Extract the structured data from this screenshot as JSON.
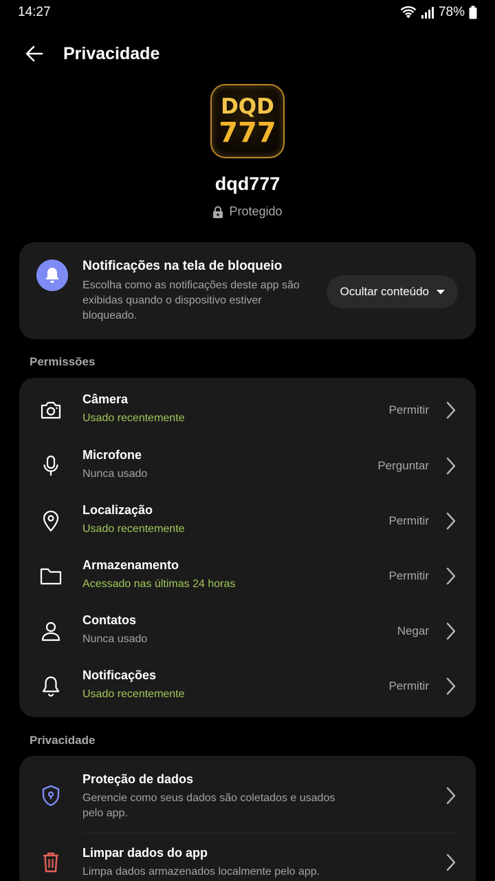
{
  "status_bar": {
    "time": "14:27",
    "battery": "78%"
  },
  "app_bar": {
    "title": "Privacidade"
  },
  "app": {
    "logo_line1": "DQD",
    "logo_line2": "777",
    "name": "dqd777",
    "protected_label": "Protegido"
  },
  "lock_screen": {
    "title": "Notificações na tela de bloqueio",
    "description": "Escolha como as notificações deste app são exibidas quando o dispositivo estiver bloqueado.",
    "dropdown_value": "Ocultar conteúdo"
  },
  "permissions": {
    "header": "Permissões",
    "items": [
      {
        "name": "Câmera",
        "status": "Usado recentemente",
        "value": "Permitir",
        "icon": "camera-icon"
      },
      {
        "name": "Microfone",
        "status": "Nunca usado",
        "value": "Perguntar",
        "icon": "microphone-icon"
      },
      {
        "name": "Localização",
        "status": "Usado recentemente",
        "value": "Permitir",
        "icon": "location-icon"
      },
      {
        "name": "Armazenamento",
        "status": "Acessado nas últimas 24 horas",
        "value": "Permitir",
        "icon": "folder-icon"
      },
      {
        "name": "Contatos",
        "status": "Nunca usado",
        "value": "Negar",
        "icon": "person-icon"
      },
      {
        "name": "Notificações",
        "status": "Usado recentemente",
        "value": "Permitir",
        "icon": "bell-icon"
      }
    ]
  },
  "privacy": {
    "header": "Privacidade",
    "items": [
      {
        "name": "Proteção de dados",
        "description": "Gerencie como seus dados são coletados e usados pelo app.",
        "icon": "shield-icon"
      },
      {
        "name": "Limpar dados do app",
        "description": "Limpa dados armazenados localmente pelo app.",
        "icon": "trash-icon"
      }
    ]
  },
  "colors": {
    "accent_purple": "#7f8bf4",
    "status_green": "#a3c75a",
    "danger_red": "#e8615a",
    "card_bg": "#1b1b1b"
  }
}
